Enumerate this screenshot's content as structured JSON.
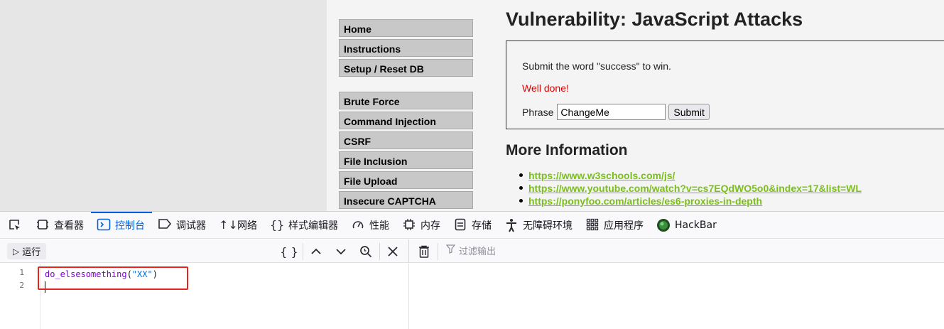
{
  "menu": {
    "group1": [
      "Home",
      "Instructions",
      "Setup / Reset DB"
    ],
    "group2": [
      "Brute Force",
      "Command Injection",
      "CSRF",
      "File Inclusion",
      "File Upload",
      "Insecure CAPTCHA"
    ]
  },
  "main": {
    "title": "Vulnerability: JavaScript Attacks",
    "instructions": "Submit the word \"success\" to win.",
    "result": "Well done!",
    "phrase_label": "Phrase",
    "phrase_value": "ChangeMe",
    "submit_label": "Submit",
    "more_info_heading": "More Information",
    "links": [
      "https://www.w3schools.com/js/",
      "https://www.youtube.com/watch?v=cs7EQdWO5o0&index=17&list=WL",
      "https://ponyfoo.com/articles/es6-proxies-in-depth"
    ],
    "colors": {
      "link": "#7bbf1a",
      "result": "#e00000"
    }
  },
  "devtools": {
    "tabs": [
      {
        "label": "查看器",
        "icon": "inspector-icon"
      },
      {
        "label": "控制台",
        "icon": "console-icon",
        "selected": true
      },
      {
        "label": "调试器",
        "icon": "debugger-icon"
      },
      {
        "label": "网络",
        "icon": "network-icon"
      },
      {
        "label": "样式编辑器",
        "icon": "style-editor-icon"
      },
      {
        "label": "性能",
        "icon": "performance-icon"
      },
      {
        "label": "内存",
        "icon": "memory-icon"
      },
      {
        "label": "存储",
        "icon": "storage-icon"
      },
      {
        "label": "无障碍环境",
        "icon": "accessibility-icon"
      },
      {
        "label": "应用程序",
        "icon": "application-icon"
      },
      {
        "label": "HackBar",
        "icon": "hackbar-icon"
      }
    ],
    "toolbar": {
      "run_label": "运行",
      "filter_placeholder": "过滤输出"
    },
    "editor": {
      "line_numbers": [
        "1",
        "2"
      ],
      "code_fn": "do_elsesomething",
      "code_open": "(",
      "code_str": "\"XX\"",
      "code_close": ")"
    },
    "accent_color": "#0061e0"
  }
}
